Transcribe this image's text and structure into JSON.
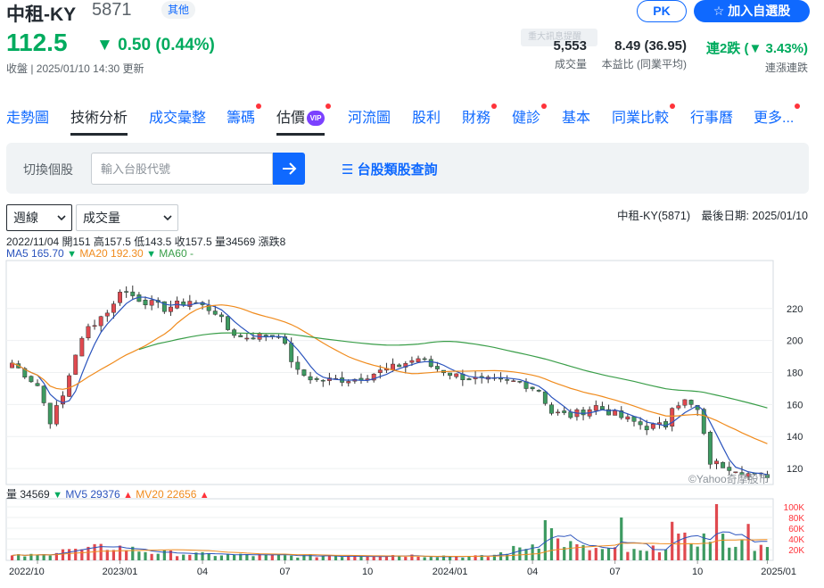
{
  "stock": {
    "name": "中租-KY",
    "code": "5871",
    "category": "其他",
    "price": "112.5",
    "change": "▼ 0.50 (0.44%)",
    "timestamp": "收盤 | 2025/01/10 14:30 更新"
  },
  "actions": {
    "pk_label": "PK",
    "watch_label": "加入自選股"
  },
  "tooltip_text": "重大訊息提醒",
  "stats": [
    {
      "value": "5,553",
      "label": "成交量"
    },
    {
      "value": "8.49 (36.95)",
      "label": "本益比 (同業平均)"
    },
    {
      "value": "連2跌 (▼ 3.43%)",
      "label": "連漲連跌"
    }
  ],
  "tabs": [
    {
      "label": "走勢圖",
      "dot": false
    },
    {
      "label": "技術分析",
      "dot": false,
      "active": true
    },
    {
      "label": "成交彙整",
      "dot": false
    },
    {
      "label": "籌碼",
      "dot": true
    },
    {
      "label": "估價",
      "dot": true,
      "vip": "VIP"
    },
    {
      "label": "河流圖",
      "dot": false
    },
    {
      "label": "股利",
      "dot": false
    },
    {
      "label": "財務",
      "dot": true
    },
    {
      "label": "健診",
      "dot": true
    },
    {
      "label": "基本",
      "dot": false
    },
    {
      "label": "同業比較",
      "dot": true
    },
    {
      "label": "行事曆",
      "dot": false
    },
    {
      "label": "更多...",
      "dot": true
    }
  ],
  "search": {
    "label": "切換個股",
    "placeholder": "輸入台股代號",
    "category_link": "台股類股查詢"
  },
  "selects": {
    "period": "週線",
    "indicator": "成交量"
  },
  "last_date": "中租-KY(5871)　最後日期: 2025/01/10",
  "ohlc_text": "2022/11/04 開151 高157.5 低143.5 收157.5 量34569 漲跌8",
  "ma": {
    "ma5_label": "MA5",
    "ma5_value": "165.70",
    "ma20_label": "MA20",
    "ma20_value": "192.30",
    "ma60_label": "MA60",
    "ma60_value": "-"
  },
  "volume_info": {
    "vol_label": "量",
    "vol_value": "34569",
    "mv5_label": "MV5",
    "mv5_value": "29376",
    "mv20_label": "MV20",
    "mv20_value": "22656"
  },
  "watermark": "©Yahoo奇摩股市",
  "colors": {
    "accent": "#0f69ff",
    "down": "#00ab5e",
    "up": "#ff333a",
    "ma5": "#2a53bd",
    "ma20": "#f08b1d",
    "ma60": "#3a9e49"
  },
  "chart_data": {
    "type": "candlestick",
    "price_axis": {
      "ticks": [
        120,
        140,
        160,
        180,
        200,
        220
      ],
      "range": [
        110,
        250
      ]
    },
    "volume_axis": {
      "ticks": [
        "20K",
        "40K",
        "60K",
        "80K",
        "100K"
      ],
      "range": [
        0,
        115000
      ]
    },
    "x_ticks": [
      "2022/10",
      "2023/01",
      "04",
      "07",
      "10",
      "2024/01",
      "04",
      "07",
      "10",
      "2025/01"
    ],
    "weeks": 120,
    "price_anchors": [
      [
        0,
        186
      ],
      [
        4,
        172
      ],
      [
        6,
        150
      ],
      [
        8,
        165
      ],
      [
        10,
        192
      ],
      [
        12,
        208
      ],
      [
        16,
        222
      ],
      [
        17,
        232
      ],
      [
        20,
        226
      ],
      [
        24,
        220
      ],
      [
        28,
        225
      ],
      [
        32,
        218
      ],
      [
        34,
        207
      ],
      [
        36,
        202
      ],
      [
        42,
        204
      ],
      [
        45,
        180
      ],
      [
        48,
        175
      ],
      [
        54,
        176
      ],
      [
        60,
        183
      ],
      [
        64,
        189
      ],
      [
        66,
        184
      ],
      [
        70,
        178
      ],
      [
        74,
        175
      ],
      [
        80,
        174
      ],
      [
        83,
        169
      ],
      [
        85,
        155
      ],
      [
        88,
        153
      ],
      [
        92,
        159
      ],
      [
        96,
        152
      ],
      [
        100,
        146
      ],
      [
        103,
        147
      ],
      [
        104,
        160
      ],
      [
        106,
        162
      ],
      [
        108,
        156
      ],
      [
        110,
        124
      ],
      [
        114,
        120
      ],
      [
        117,
        115
      ],
      [
        119,
        116
      ]
    ],
    "volume_anchors": [
      [
        0,
        8000
      ],
      [
        5,
        10000
      ],
      [
        8,
        24000
      ],
      [
        10,
        18000
      ],
      [
        16,
        26000
      ],
      [
        22,
        15000
      ],
      [
        30,
        11000
      ],
      [
        45,
        8000
      ],
      [
        60,
        10000
      ],
      [
        75,
        7000
      ],
      [
        85,
        40000
      ],
      [
        90,
        22000
      ],
      [
        100,
        15000
      ],
      [
        104,
        35000
      ],
      [
        110,
        42000
      ],
      [
        116,
        28000
      ],
      [
        119,
        20000
      ]
    ],
    "spike_weeks": [
      [
        84,
        75000
      ],
      [
        85,
        60000
      ],
      [
        96,
        80000
      ],
      [
        104,
        72000
      ],
      [
        111,
        105000
      ],
      [
        116,
        68000
      ]
    ]
  }
}
